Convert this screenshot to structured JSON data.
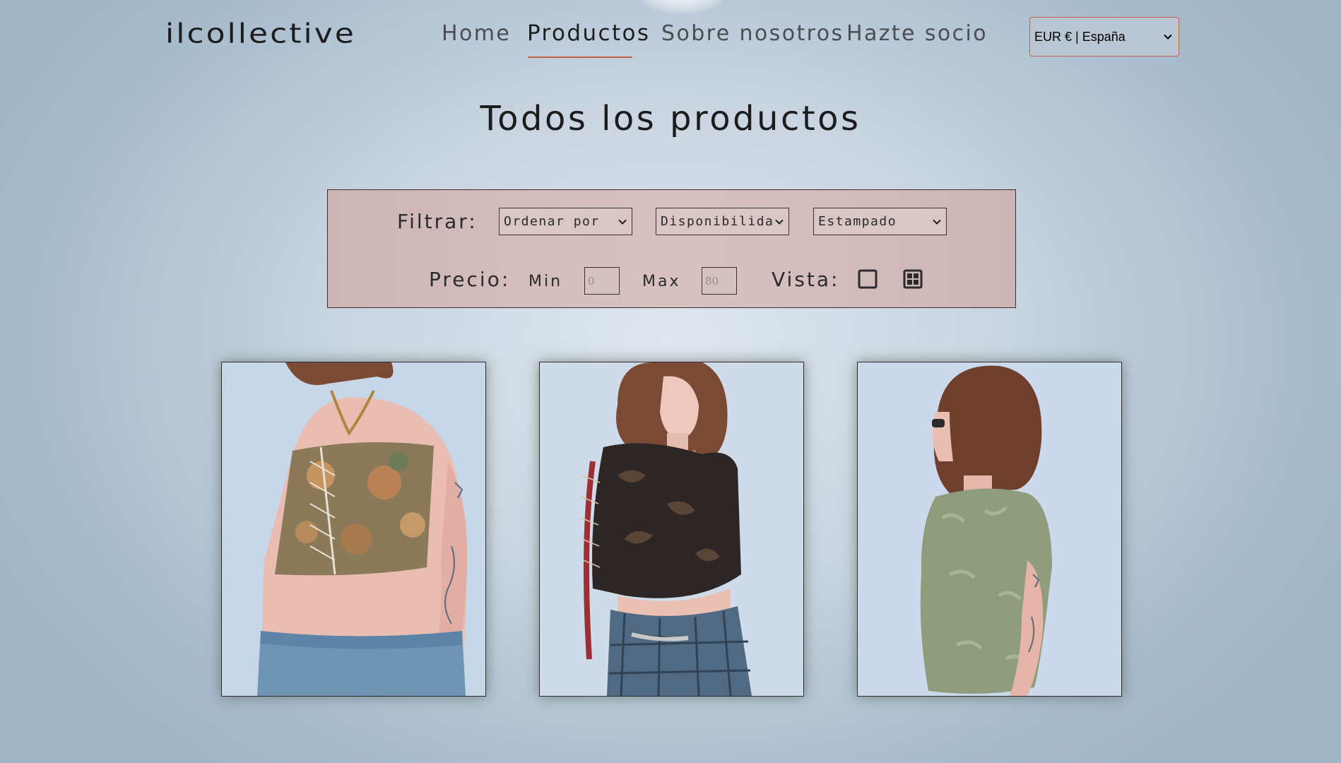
{
  "header": {
    "logo": "ilcollective",
    "nav": [
      {
        "label": "Home",
        "active": false
      },
      {
        "label": "Productos",
        "active": true
      },
      {
        "label": "Sobre nosotros",
        "active": false
      },
      {
        "label": "Hazte socio",
        "active": false
      }
    ],
    "currency_selected": "EUR € | España"
  },
  "main": {
    "title": "Todos los productos",
    "filters": {
      "filter_label": "Filtrar:",
      "sort_select": "Ordenar por",
      "availability_select": "Disponibilidad",
      "print_select": "Estampado",
      "price_label": "Precio:",
      "min_label": "Min",
      "min_placeholder": "0",
      "max_label": "Max",
      "max_placeholder": "80",
      "view_label": "Vista:",
      "view_icons": [
        "square-view-icon",
        "grid-view-icon"
      ]
    },
    "products": [
      {
        "image": "floral-lace-up-corset-top-photo"
      },
      {
        "image": "black-paisley-lace-up-top-photo"
      },
      {
        "image": "green-fuzzy-knit-tee-photo"
      }
    ]
  },
  "colors": {
    "accent": "#c0634a",
    "filter_panel": "#d4bebd",
    "background": "#c9d5e1",
    "text": "#1e1e1e"
  }
}
